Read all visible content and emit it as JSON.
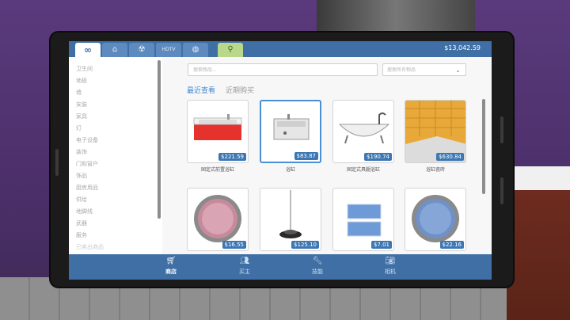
{
  "app": {
    "money": "$13,042.59",
    "top_tabs": [
      {
        "name": "infinity",
        "glyph": "∞"
      },
      {
        "name": "home",
        "glyph": "⌂"
      },
      {
        "name": "radiation",
        "glyph": "☢"
      },
      {
        "name": "hdtv",
        "glyph": "HDTV"
      },
      {
        "name": "globe",
        "glyph": "◍"
      },
      {
        "name": "location",
        "glyph": "⚲"
      }
    ]
  },
  "sidebar": {
    "categories": [
      "卫生间",
      "地板",
      "墙",
      "安装",
      "家具",
      "灯",
      "电子设备",
      "装饰",
      "门和窗户",
      "饰品",
      "厨房用品",
      "供给",
      "地脚线",
      "武器",
      "服务",
      "已卖出商品"
    ]
  },
  "search": {
    "placeholder": "搜索物品...",
    "filter_placeholder": "搜索所有物品"
  },
  "subtabs": {
    "recent_view": "最近查看",
    "recent_buy": "近期购买"
  },
  "items": [
    {
      "price": "$221.59",
      "label": "固定式前置浴缸"
    },
    {
      "price": "$83.87",
      "label": "浴缸"
    },
    {
      "price": "$190.74",
      "label": "固定式具腿浴缸"
    },
    {
      "price": "$630.84",
      "label": "浴缸瓷砖"
    },
    {
      "price": "$16.55",
      "label": ""
    },
    {
      "price": "$125.10",
      "label": ""
    },
    {
      "price": "$7.01",
      "label": ""
    },
    {
      "price": "$22.16",
      "label": ""
    }
  ],
  "bottom_nav": [
    {
      "label": "商店",
      "icon": "cart-icon"
    },
    {
      "label": "买主",
      "icon": "people-icon"
    },
    {
      "label": "技能",
      "icon": "wrench-icon"
    },
    {
      "label": "相机",
      "icon": "camera-icon"
    }
  ],
  "colors": {
    "accent": "#3f6fa5",
    "price_badge": "#3d77b3",
    "selected_border": "#4a8fd2"
  }
}
